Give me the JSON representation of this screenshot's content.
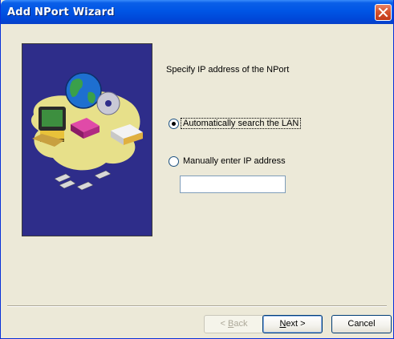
{
  "window": {
    "title": "Add NPort Wizard"
  },
  "content": {
    "heading": "Specify IP address of the NPort",
    "options": [
      {
        "label": "Automatically search the LAN",
        "selected": true
      },
      {
        "label": "Manually enter IP address",
        "selected": false
      }
    ],
    "ip_input": {
      "value": "",
      "placeholder": ""
    }
  },
  "buttons": {
    "back": {
      "mnemonic": "B",
      "rest": "ack",
      "prefix": "< ",
      "enabled": false
    },
    "next": {
      "mnemonic": "N",
      "rest": "ext >",
      "enabled": true
    },
    "cancel": {
      "label": "Cancel",
      "enabled": true
    }
  },
  "colors": {
    "title_bar": "#0055e5",
    "dialog_bg": "#ece9d8",
    "image_bg": "#2e2d8a"
  }
}
